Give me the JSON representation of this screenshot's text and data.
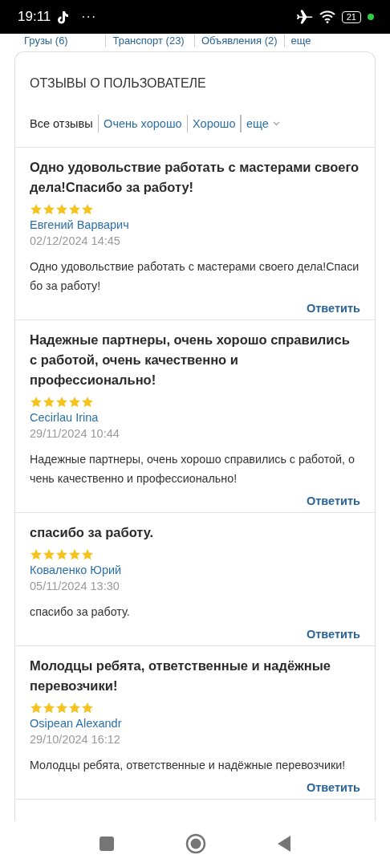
{
  "status_bar": {
    "time": "19:11",
    "more": "···",
    "battery": "21"
  },
  "top_tabs": [
    {
      "label": "Грузы (6)"
    },
    {
      "label": "Транспорт (23)"
    },
    {
      "label": "Объявления (2)"
    },
    {
      "label": "еще"
    }
  ],
  "reviews_card": {
    "title": "ОТЗЫВЫ О ПОЛЬЗОВАТЕЛЕ",
    "filters": [
      {
        "label": "Все отзывы",
        "selected": true,
        "kind": "link"
      },
      {
        "label": "Очень хорошо",
        "selected": false,
        "kind": "link"
      },
      {
        "label": "Хорошо",
        "selected": false,
        "kind": "link"
      },
      {
        "label": "еще",
        "selected": false,
        "kind": "dropdown"
      }
    ],
    "reviews": [
      {
        "title": "Одно удовольствие работать с мастерами своего дела!Спасибо за работу!",
        "stars": 5,
        "author": "Евгений Варварич",
        "date": "02/12/2024 14:45",
        "text": "Одно удовольствие работать с мастерами своего дела!Спасибо за работу!",
        "reply": "Ответить"
      },
      {
        "title": "Надежные партнеры, очень хорошо справились с работой, очень качественно и профессионально!",
        "stars": 5,
        "author": "Cecirlau Irina",
        "date": "29/11/2024 10:44",
        "text": "Надежные партнеры, очень хорошо справились с работой, очень качественно и профессионально!",
        "reply": "Ответить"
      },
      {
        "title": "спасибо за работу.",
        "stars": 5,
        "author": "Коваленко Юрий",
        "date": "05/11/2024 13:30",
        "text": "спасибо за работу.",
        "reply": "Ответить"
      },
      {
        "title": "Молодцы ребята, ответственные и надёжные перевозчики!",
        "stars": 5,
        "author": "Osipean Alexandr",
        "date": "29/10/2024 16:12",
        "text": "Молодцы ребята, ответственные и надёжные перевозчики!",
        "reply": "Ответить"
      }
    ]
  }
}
